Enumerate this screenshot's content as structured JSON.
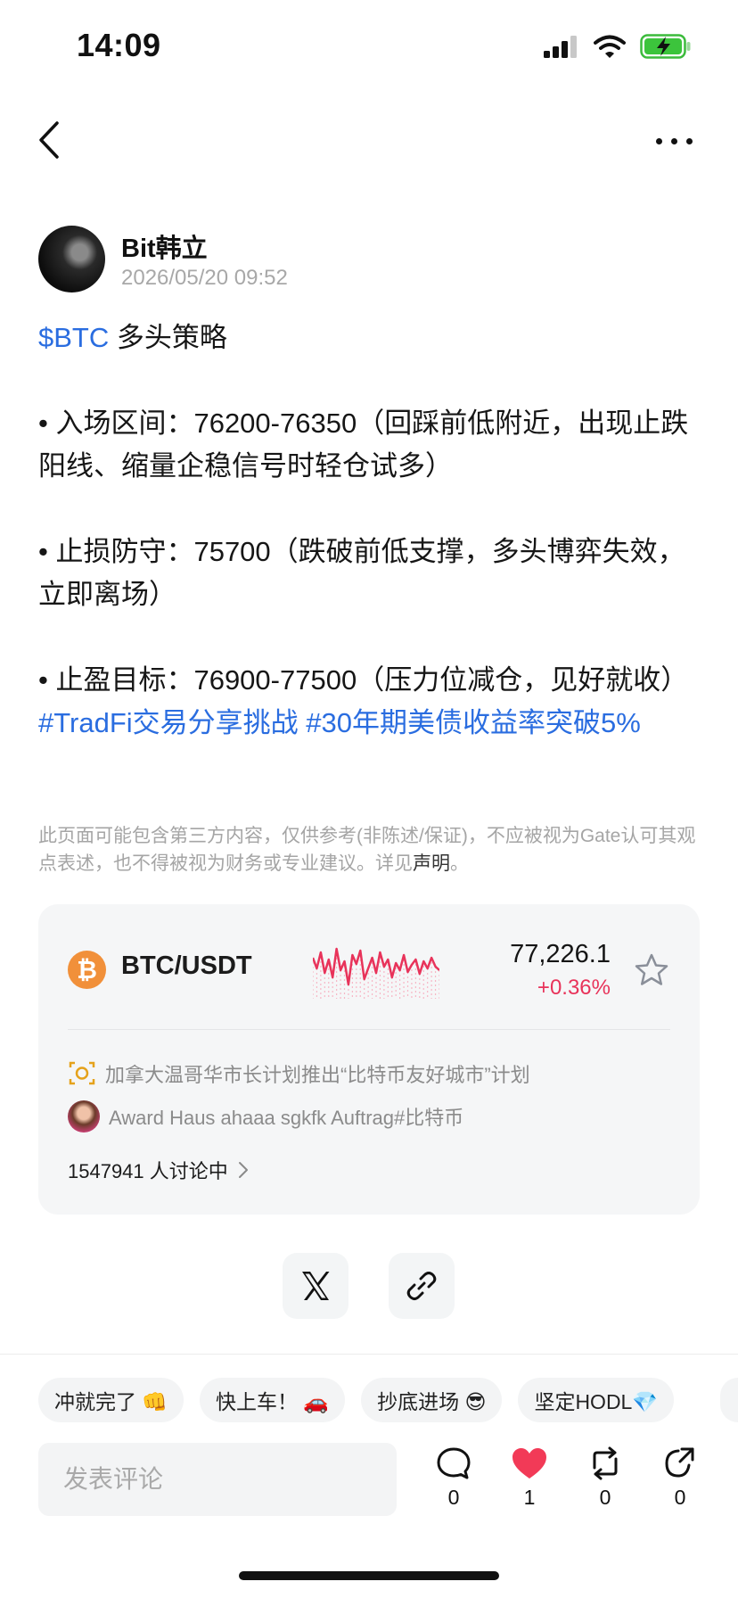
{
  "status_bar": {
    "time": "14:09"
  },
  "author": {
    "name": "Bit韩立",
    "timestamp": "2026/05/20 09:52"
  },
  "post": {
    "ticker": "$BTC",
    "title": " 多头策略",
    "entry": "• 入场区间：76200-76350（回踩前低附近，出现止跌阳线、缩量企稳信号时轻仓试多）",
    "stop": "• 止损防守：75700（跌破前低支撑，多头博弈失效，立即离场）",
    "target": "• 止盈目标：76900-77500（压力位减仓，见好就收）",
    "hashtag_1": "#TradFi交易分享挑战",
    "hashtag_2": "#30年期美债收益率突破5%"
  },
  "disclaimer": {
    "text": "此页面可能包含第三方内容，仅供参考(非陈述/保证)，不应被视为Gate认可其观点表述，也不得被视为财务或专业建议。详见",
    "link": "声明",
    "end": "。"
  },
  "market_card": {
    "logo_glyph": "₿",
    "pair": "BTC/USDT",
    "price": "77,226.1",
    "change": "+0.36%",
    "accent_color": "#e8335a",
    "sparkline": [
      52,
      40,
      58,
      35,
      50,
      30,
      62,
      38,
      48,
      22,
      55,
      45,
      60,
      28,
      40,
      52,
      35,
      58,
      42,
      50,
      30,
      46,
      38,
      55,
      36,
      44,
      50,
      34,
      48,
      40,
      52,
      42,
      38
    ],
    "news": [
      {
        "icon": "camera-icon",
        "text": "加拿大温哥华市长计划推出“比特币友好城市”计划"
      },
      {
        "icon": "user-avatar",
        "text": "Award Haus ahaaa sgkfk Auftrag#比特币"
      }
    ],
    "discussion": "1547941 人讨论中"
  },
  "quick_replies": [
    "冲就完了 👊",
    "快上车！ 🚗",
    "抄底进场 😎",
    "坚定HODL💎"
  ],
  "comment": {
    "placeholder": "发表评论"
  },
  "actions": {
    "comments": "0",
    "likes": "1",
    "reposts": "0",
    "shares": "0",
    "like_color": "#f23a57"
  }
}
